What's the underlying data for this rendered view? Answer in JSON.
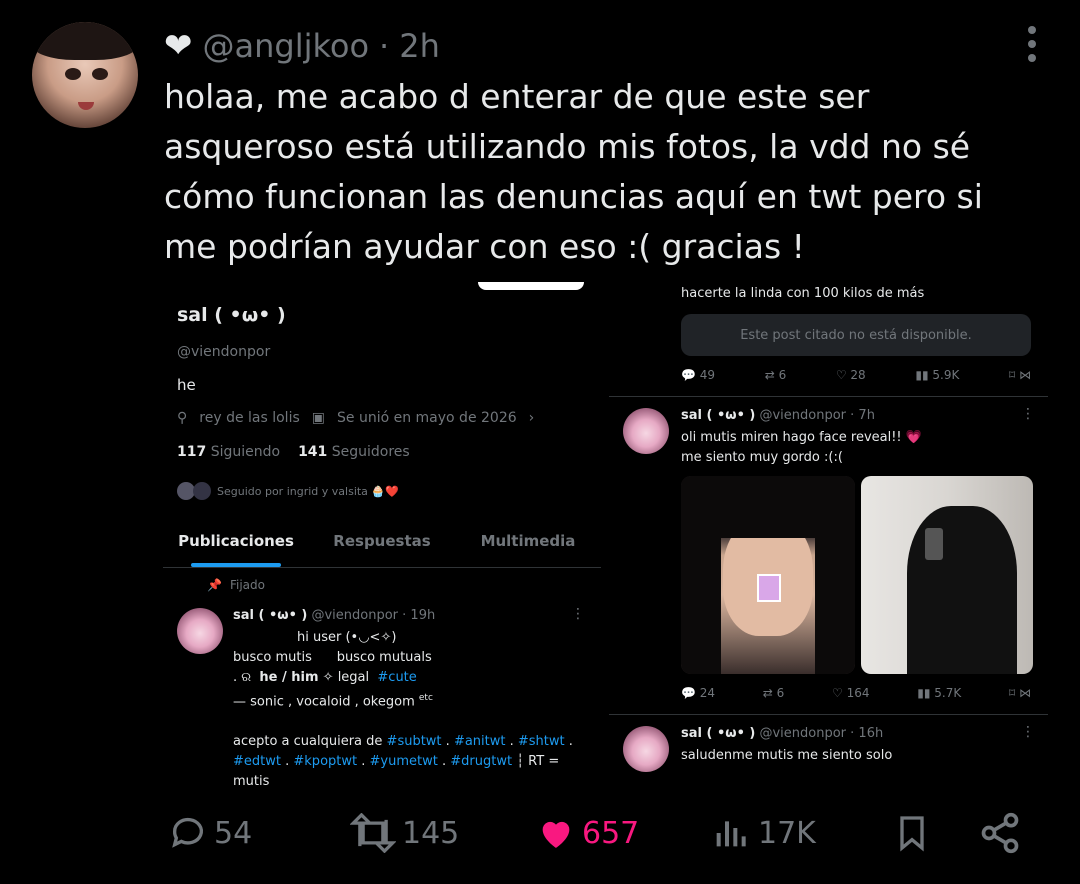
{
  "tweet": {
    "handle": "@angljkoo",
    "time": "2h",
    "text": "holaa, me acabo d enterar de que este ser asqueroso está utilizando mis fotos, la vdd no sé cómo funcionan las denuncias aquí en twt pero si me podrían ayudar con eso :( gracias !",
    "actions": {
      "replies": "54",
      "retweets": "145",
      "likes": "657",
      "views": "17K"
    },
    "like_color": "#f91880"
  },
  "screenshot": {
    "profile": {
      "name": "sal ( •ω• )",
      "handle": "@viendonpor",
      "bio": "he",
      "location": "rey de las lolis",
      "joined": "Se unió en mayo de 2026",
      "following_count": "117",
      "following_label": "Siguiendo",
      "followers_count": "141",
      "followers_label": "Seguidores",
      "followed_by": "Seguido por ingrid y valsita 🧁❤️"
    },
    "tabs": [
      "Publicaciones",
      "Respuestas",
      "Multimedia"
    ],
    "pinned_label": "Fijado",
    "pinned_post": {
      "name": "sal ( •ω• )",
      "meta": "@viendonpor · 19h",
      "line1": "hi user  (•◡<✧)",
      "line2a": "busco mutis",
      "line2b": "busco mutuals",
      "line3a": ".   ର",
      "line3b": "he / him",
      "line3c": "✧  legal",
      "line3d": "#cute",
      "line4": "— sonic , vocaloid , okegom",
      "line4sup": "etc",
      "line5": "acepto a cualquiera de",
      "tags1": [
        "#subtwt",
        "#anitwt",
        "#shtwt"
      ],
      "tags2": [
        "#edtwt",
        "#kpoptwt",
        "#yumetwt",
        "#drugtwt"
      ],
      "rt": "RT =",
      "line7": "mutis"
    },
    "right_posts": [
      {
        "text": "hacerte la linda con 100 kilos de más",
        "quote": "Este post citado no está disponible.",
        "replies": "49",
        "retweets": "6",
        "likes": "28",
        "views": "5.9K"
      },
      {
        "name": "sal ( •ω• )",
        "meta": "@viendonpor · 7h",
        "line1": "oli mutis miren hago face reveal!! 💗",
        "line2": "me siento muy gordo :(:(",
        "replies": "24",
        "retweets": "6",
        "likes": "164",
        "views": "5.7K"
      },
      {
        "name": "sal ( •ω• )",
        "meta": "@viendonpor · 16h",
        "line1": "saludenme mutis me siento solo"
      }
    ]
  }
}
